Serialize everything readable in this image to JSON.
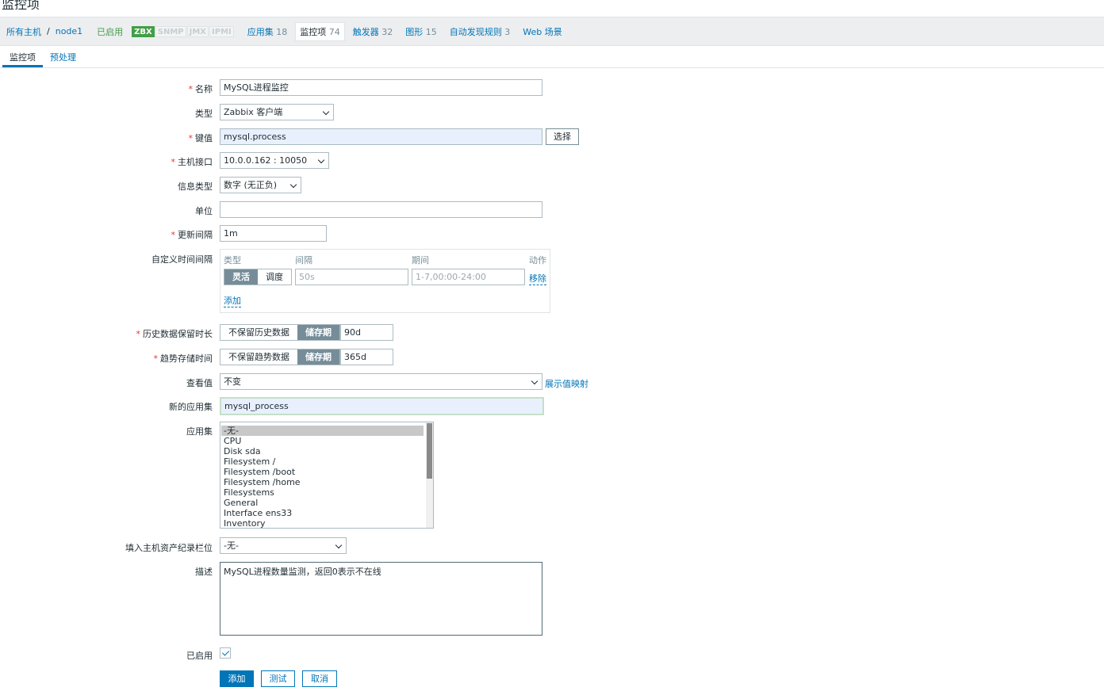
{
  "page": {
    "title": "监控项"
  },
  "hostnav": {
    "all_hosts": "所有主机",
    "separator": "/",
    "host": "node1",
    "status": "已启用",
    "badges": [
      "ZBX",
      "SNMP",
      "JMX",
      "IPMI"
    ],
    "items": [
      {
        "label": "应用集",
        "count": "18",
        "active": false
      },
      {
        "label": "监控项",
        "count": "74",
        "active": true
      },
      {
        "label": "触发器",
        "count": "32",
        "active": false
      },
      {
        "label": "图形",
        "count": "15",
        "active": false
      },
      {
        "label": "自动发现规则",
        "count": "3",
        "active": false
      },
      {
        "label": "Web 场景",
        "count": "",
        "active": false
      }
    ]
  },
  "tabs": [
    "监控项",
    "预处理"
  ],
  "form": {
    "required_mark": "*",
    "name": {
      "label": "名称",
      "value": "MySQL进程监控"
    },
    "type": {
      "label": "类型",
      "value": "Zabbix 客户端"
    },
    "key": {
      "label": "键值",
      "value": "mysql.process",
      "select_button": "选择"
    },
    "interface": {
      "label": "主机接口",
      "value": "10.0.0.162 : 10050"
    },
    "info_type": {
      "label": "信息类型",
      "value": "数字 (无正负)"
    },
    "units": {
      "label": "单位",
      "value": ""
    },
    "update_interval": {
      "label": "更新间隔",
      "value": "1m"
    },
    "custom_intervals": {
      "label": "自定义时间间隔",
      "headers": {
        "type": "类型",
        "interval": "间隔",
        "period": "期间",
        "action": "动作"
      },
      "row": {
        "type_options": [
          "灵活",
          "调度"
        ],
        "interval_placeholder": "50s",
        "period_placeholder": "1-7,00:00-24:00",
        "remove": "移除"
      },
      "add": "添加"
    },
    "history": {
      "label": "历史数据保留时长",
      "options": [
        "不保留历史数据",
        "储存期"
      ],
      "value": "90d"
    },
    "trends": {
      "label": "趋势存储时间",
      "options": [
        "不保留趋势数据",
        "储存期"
      ],
      "value": "365d"
    },
    "valuemap": {
      "label": "查看值",
      "value": "不变",
      "link": "展示值映射"
    },
    "new_application": {
      "label": "新的应用集",
      "value": "mysql_process"
    },
    "applications": {
      "label": "应用集",
      "options": [
        "-无-",
        "CPU",
        "Disk sda",
        "Filesystem /",
        "Filesystem /boot",
        "Filesystem /home",
        "Filesystems",
        "General",
        "Interface ens33",
        "Inventory"
      ]
    },
    "inventory": {
      "label": "填入主机资产纪录栏位",
      "value": "-无-"
    },
    "description": {
      "label": "描述",
      "value": "MySQL进程数量监测，返回0表示不在线"
    },
    "enabled": {
      "label": "已启用"
    },
    "buttons": {
      "add": "添加",
      "test": "测试",
      "cancel": "取消"
    }
  }
}
